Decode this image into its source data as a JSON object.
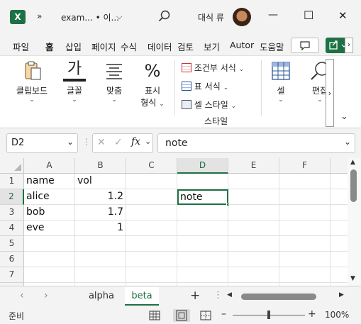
{
  "titlebar": {
    "app_icon": "excel-logo",
    "app_letter": "X",
    "more_glyph": "»",
    "doc_title": "exam... • 이...",
    "title_chevron": "chevron-down-icon",
    "search_icon": "search-icon",
    "user_name": "대식 류",
    "min_glyph": "—",
    "max_glyph": "☐",
    "close_glyph": "✕"
  },
  "ribbon_tabs": [
    "파일",
    "홈",
    "삽입",
    "페이지",
    "수식",
    "데이터",
    "검토",
    "보기",
    "Autor",
    "도움말"
  ],
  "ribbon_active_tab": "홈",
  "ribbon": {
    "clipboard": "클립보드",
    "font": "글꼴",
    "font_glyph": "가",
    "alignment": "맞춤",
    "number_line1": "표시",
    "number_line2": "형식",
    "number_glyph": "%",
    "cond_format": "조건부 서식",
    "table_format": "표 서식",
    "cell_style": "셀 스타일",
    "styles_group": "스타일",
    "cells": "셀",
    "editing": "편집"
  },
  "formula_bar": {
    "name_box": "D2",
    "fx_label": "fx",
    "formula_value": "note"
  },
  "grid": {
    "columns": [
      "A",
      "B",
      "C",
      "D",
      "E",
      "F"
    ],
    "selected_column": "D",
    "rows": [
      "1",
      "2",
      "3",
      "4",
      "5",
      "6",
      "7"
    ],
    "selected_row": "2",
    "cells": {
      "A1": "name",
      "B1": "vol",
      "A2": "alice",
      "B2": "1.2",
      "D2": "note",
      "A3": "bob",
      "B3": "1.7",
      "A4": "eve",
      "B4": "1"
    },
    "active_cell": "D2"
  },
  "sheets": {
    "tabs": [
      "alpha",
      "beta"
    ],
    "active": "beta"
  },
  "status": {
    "mode": "준비",
    "zoom": "100%",
    "zoom_fraction": 1.0
  },
  "colors": {
    "accent": "#1e7145",
    "chrome": "#f3f3f3"
  }
}
